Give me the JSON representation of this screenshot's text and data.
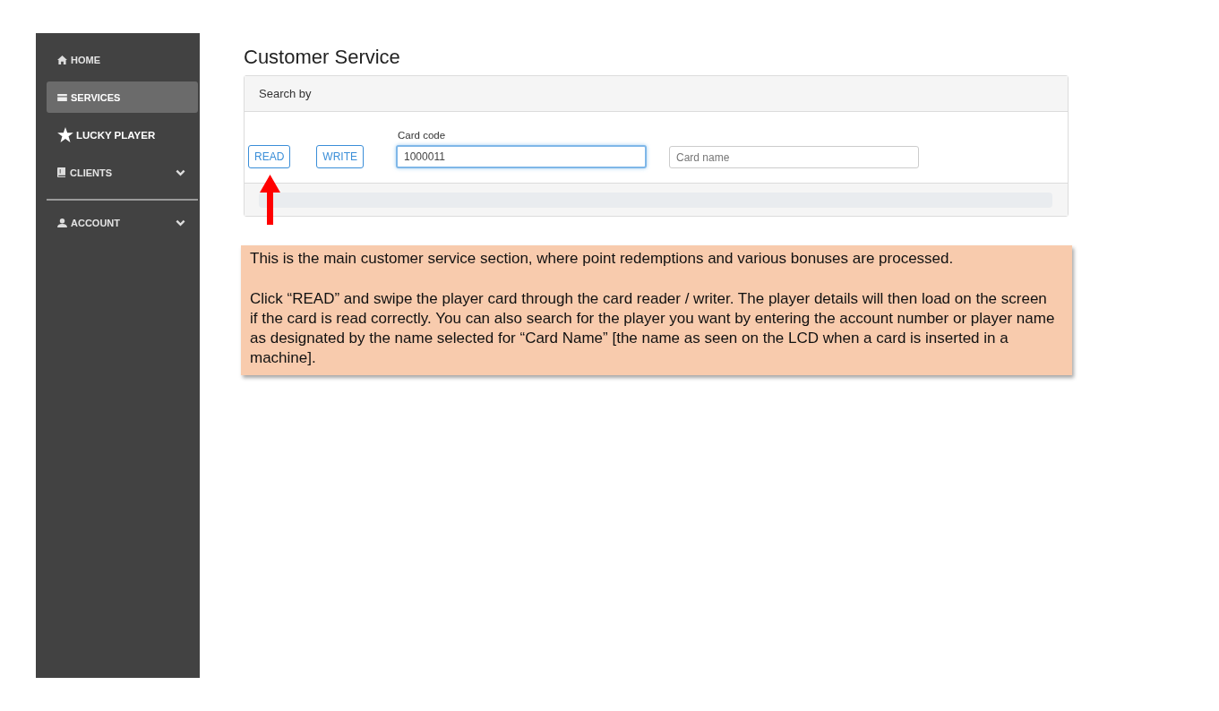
{
  "sidebar": {
    "sections": [
      {
        "items": [
          {
            "label": "HOME",
            "kind": "link",
            "selected": false
          },
          {
            "label": "SERVICES",
            "kind": "link",
            "selected": true
          },
          {
            "label": "LUCKY PLAYER",
            "kind": "link",
            "selected": false
          },
          {
            "label": "CLIENTS",
            "kind": "group",
            "selected": false,
            "expanded": false
          }
        ]
      },
      {
        "items": [
          {
            "label": "ACCOUNT",
            "kind": "group",
            "selected": false,
            "expanded": false
          }
        ]
      }
    ]
  },
  "page_title": "Customer Service",
  "search_panel": {
    "header": "Search by",
    "buttons": [
      "READ",
      "WRITE"
    ],
    "card_code": {
      "label": "Card code",
      "value": "1000011",
      "focused": true
    },
    "card_name": {
      "placeholder": "Card name",
      "focused": false
    }
  },
  "note": {
    "paragraphs": [
      "This is the main customer service section, where point redemptions and various bonuses are processed.",
      "Click “READ” and swipe the player card through the card reader / writer. The player details will then load on the screen if the card is read correctly. You can also search for the player you want by entering the account number or player name as designated by the name selected for “Card Name” [the name as seen on the LCD when a card is inserted in a machine]."
    ]
  }
}
